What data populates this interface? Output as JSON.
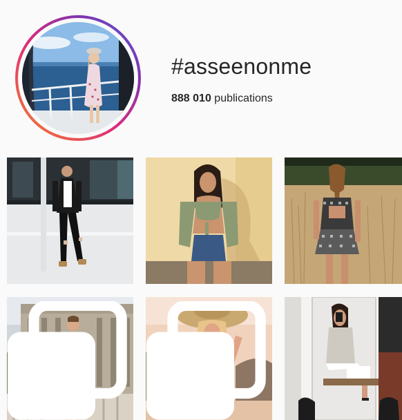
{
  "hashtag": {
    "title": "#asseenonme",
    "post_count": "888 010",
    "post_count_label": "publications"
  },
  "grid": {
    "posts": [
      {
        "name": "post-1",
        "icon": null
      },
      {
        "name": "post-2",
        "icon": null
      },
      {
        "name": "post-3",
        "icon": null
      },
      {
        "name": "post-4",
        "icon": "multiple-photos-icon"
      },
      {
        "name": "post-5",
        "icon": "multiple-photos-icon"
      },
      {
        "name": "post-6",
        "icon": null
      }
    ]
  },
  "colors": {
    "ring_gradient": [
      "#f58529",
      "#dd2a7b",
      "#8134af",
      "#515bd4"
    ],
    "background": "#fafafa",
    "text": "#262626"
  }
}
